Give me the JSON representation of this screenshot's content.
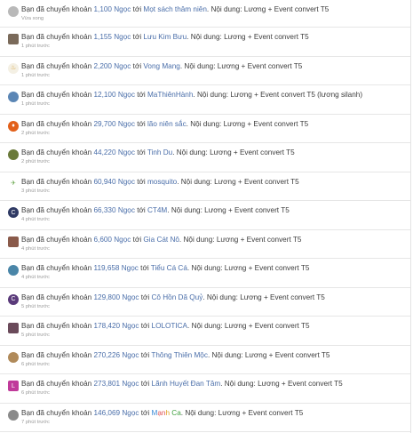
{
  "labels": {
    "prefix": "Bạn đã chuyển khoản",
    "to": "tới",
    "content": "Nội dung:"
  },
  "items": [
    {
      "amount": "1,100 Ngọc",
      "recipient": "Mọt sách thâm niên",
      "note": "Lương + Event convert T5",
      "time": "Vừa xong",
      "avatar": {
        "icon": "person-photo-icon",
        "color": "#b9b9b9",
        "glyph": "",
        "square": false
      }
    },
    {
      "amount": "1,155 Ngọc",
      "recipient": "Lưu Kim Bưu",
      "note": "Lương + Event convert T5",
      "time": "1 phút trước",
      "avatar": {
        "icon": "person-photo-icon",
        "color": "#7a6a5a",
        "glyph": "",
        "square": true
      }
    },
    {
      "amount": "2,200 Ngọc",
      "recipient": "Vong Mang",
      "note": "Lương + Event convert T5",
      "time": "1 phút trước",
      "avatar": {
        "icon": "candle-icon",
        "color": "#f4f0e4",
        "glyph": "♨",
        "square": false
      }
    },
    {
      "amount": "12,100 Ngọc",
      "recipient": "MaThiênHành",
      "note": "Lương + Event convert T5 (lương silanh)",
      "time": "1 phút trước",
      "avatar": {
        "icon": "anime-avatar-icon",
        "color": "#5b86b5",
        "glyph": "",
        "square": false
      }
    },
    {
      "amount": "29,700 Ngọc",
      "recipient": "lão niên sắc",
      "note": "Lương + Event convert T5",
      "time": "2 phút trước",
      "avatar": {
        "icon": "flame-icon",
        "color": "#e2601a",
        "glyph": "♦",
        "square": false
      }
    },
    {
      "amount": "44,220 Ngọc",
      "recipient": "Tinh Du",
      "note": "Lương + Event convert T5",
      "time": "2 phút trước",
      "avatar": {
        "icon": "animal-avatar-icon",
        "color": "#6a7a3a",
        "glyph": "",
        "square": false
      }
    },
    {
      "amount": "60,940 Ngọc",
      "recipient": "mosquito",
      "note": "Lương + Event convert T5",
      "time": "3 phút trước",
      "avatar": {
        "icon": "mosquito-icon",
        "color": "#ffffff",
        "glyph": "✈",
        "square": false
      }
    },
    {
      "amount": "66,330 Ngọc",
      "recipient": "CT4M",
      "note": "Lương + Event convert T5",
      "time": "4 phút trước",
      "avatar": {
        "icon": "letter-c-icon",
        "color": "#2f3a64",
        "glyph": "C",
        "square": false
      }
    },
    {
      "amount": "6,600 Ngọc",
      "recipient": "Gia Cát Nô",
      "note": "Lương + Event convert T5",
      "time": "4 phút trước",
      "avatar": {
        "icon": "person-photo-icon",
        "color": "#8a5a4a",
        "glyph": "",
        "square": true
      }
    },
    {
      "amount": "119,658 Ngọc",
      "recipient": "Tiểu Cá Cá",
      "note": "Lương + Event convert T5",
      "time": "4 phút trước",
      "avatar": {
        "icon": "fish-avatar-icon",
        "color": "#4a86a8",
        "glyph": "",
        "square": false
      }
    },
    {
      "amount": "129,800 Ngọc",
      "recipient": "Cô Hồn Dã Quỷ",
      "note": "Lương + Event convert T5",
      "time": "5 phút trước",
      "avatar": {
        "icon": "letter-c-icon",
        "color": "#5a3a7a",
        "glyph": "C",
        "square": false
      }
    },
    {
      "amount": "178,420 Ngọc",
      "recipient": "LOLOTICA",
      "note": "Lương + Event convert T5",
      "time": "5 phút trước",
      "avatar": {
        "icon": "person-photo-icon",
        "color": "#6a4a5a",
        "glyph": "",
        "square": true
      }
    },
    {
      "amount": "270,226 Ngọc",
      "recipient": "Thông Thiên Mộc",
      "note": "Lương + Event convert T5",
      "time": "6 phút trước",
      "avatar": {
        "icon": "group-avatar-icon",
        "color": "#b08a5a",
        "glyph": "",
        "square": false
      }
    },
    {
      "amount": "273,801 Ngọc",
      "recipient": "Lãnh Huyết Đan Tâm",
      "note": "Lương + Event convert T5",
      "time": "6 phút trước",
      "avatar": {
        "icon": "letter-l-icon",
        "color": "#c03a9a",
        "glyph": "L",
        "square": true
      }
    },
    {
      "amount": "146,069 Ngọc",
      "recipient": "Mạnh Ca",
      "note": "Lương + Event convert T5",
      "time": "7 phút trước",
      "avatar": {
        "icon": "person-photo-icon",
        "color": "#8a8a8a",
        "glyph": "",
        "square": false
      },
      "rainbow": true
    }
  ]
}
